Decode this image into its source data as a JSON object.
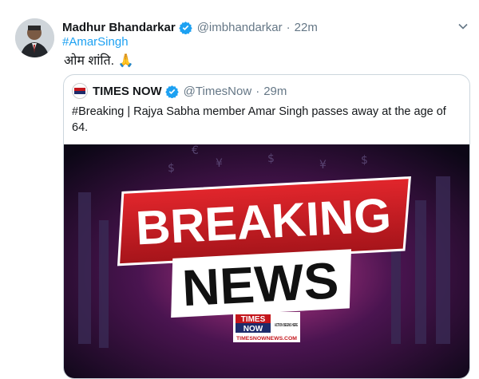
{
  "tweet": {
    "author_name": "Madhur Bhandarkar",
    "author_handle": "@imbhandarkar",
    "separator": "·",
    "time": "22m",
    "hashtag": "#AmarSingh",
    "body": "ओम शांति. 🙏"
  },
  "quoted": {
    "author_name": "TIMES NOW",
    "author_handle": "@TimesNow",
    "separator": "·",
    "time": "29m",
    "text": "#Breaking | Rajya Sabha member Amar Singh passes away at the age of 64.",
    "image": {
      "banner_top": "BREAKING",
      "banner_bottom": "NEWS",
      "logo_line1": "TIMES",
      "logo_line2": "NOW",
      "logo_tag": "ACTION BEGINS HERE",
      "logo_site": "TIMESNOWNEWS.COM"
    }
  },
  "colors": {
    "link_blue": "#1da1f2",
    "verified_blue": "#1da1f2",
    "breaking_red": "#d61f26"
  }
}
